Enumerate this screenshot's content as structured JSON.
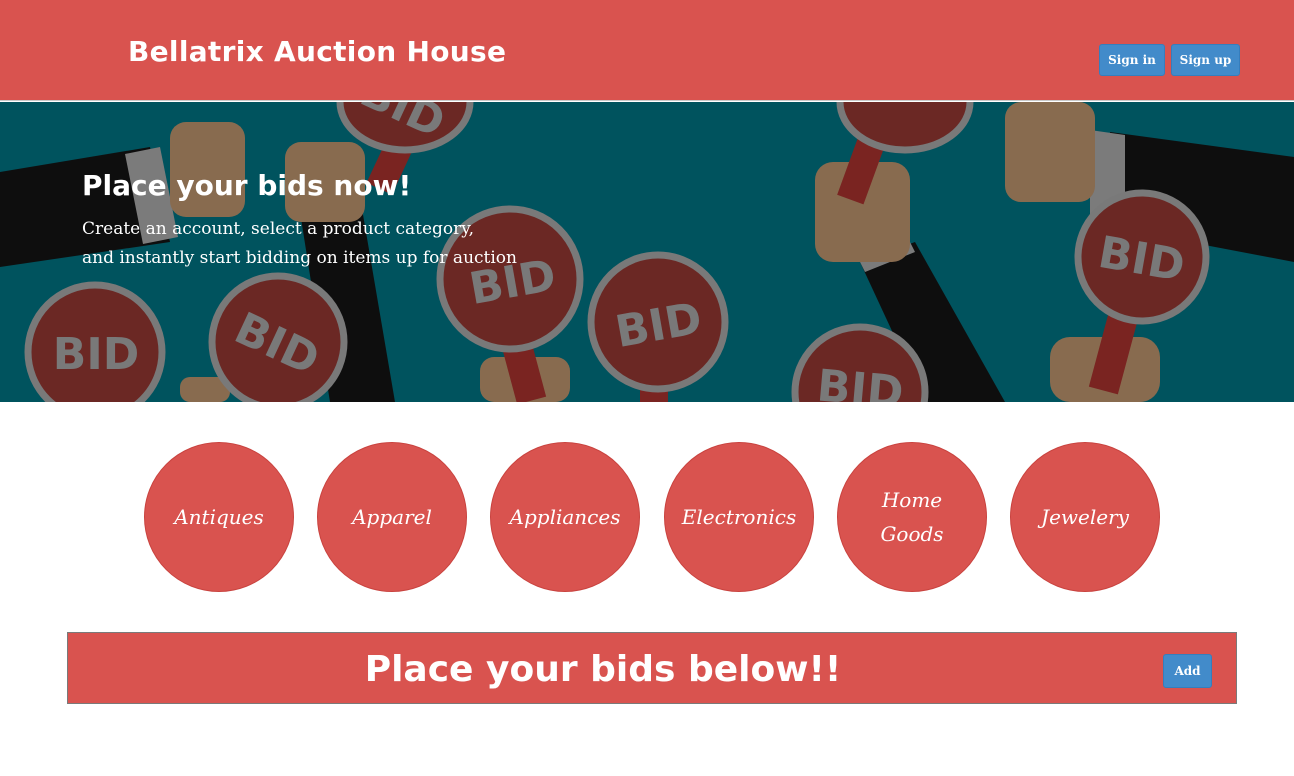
{
  "header": {
    "brand": "Bellatrix Auction House",
    "sign_in_label": "Sign in",
    "sign_up_label": "Sign up"
  },
  "hero": {
    "title": "Place your bids now!",
    "subtitle_line1": "Create an account, select a product category,",
    "subtitle_line2": "and instantly start bidding on items up for auction",
    "paddle_text": "BID"
  },
  "categories": [
    {
      "label": "Antiques"
    },
    {
      "label": "Apparel"
    },
    {
      "label": "Appliances"
    },
    {
      "label": "Electronics"
    },
    {
      "label": "Home Goods"
    },
    {
      "label": "Jewelery"
    }
  ],
  "bids": {
    "title": "Place your bids below!!",
    "add_label": "Add"
  },
  "colors": {
    "brand_red": "#d9534f",
    "button_blue": "#428bca",
    "hero_teal": "#005f6b",
    "paddle_red": "#7a2e2a"
  }
}
